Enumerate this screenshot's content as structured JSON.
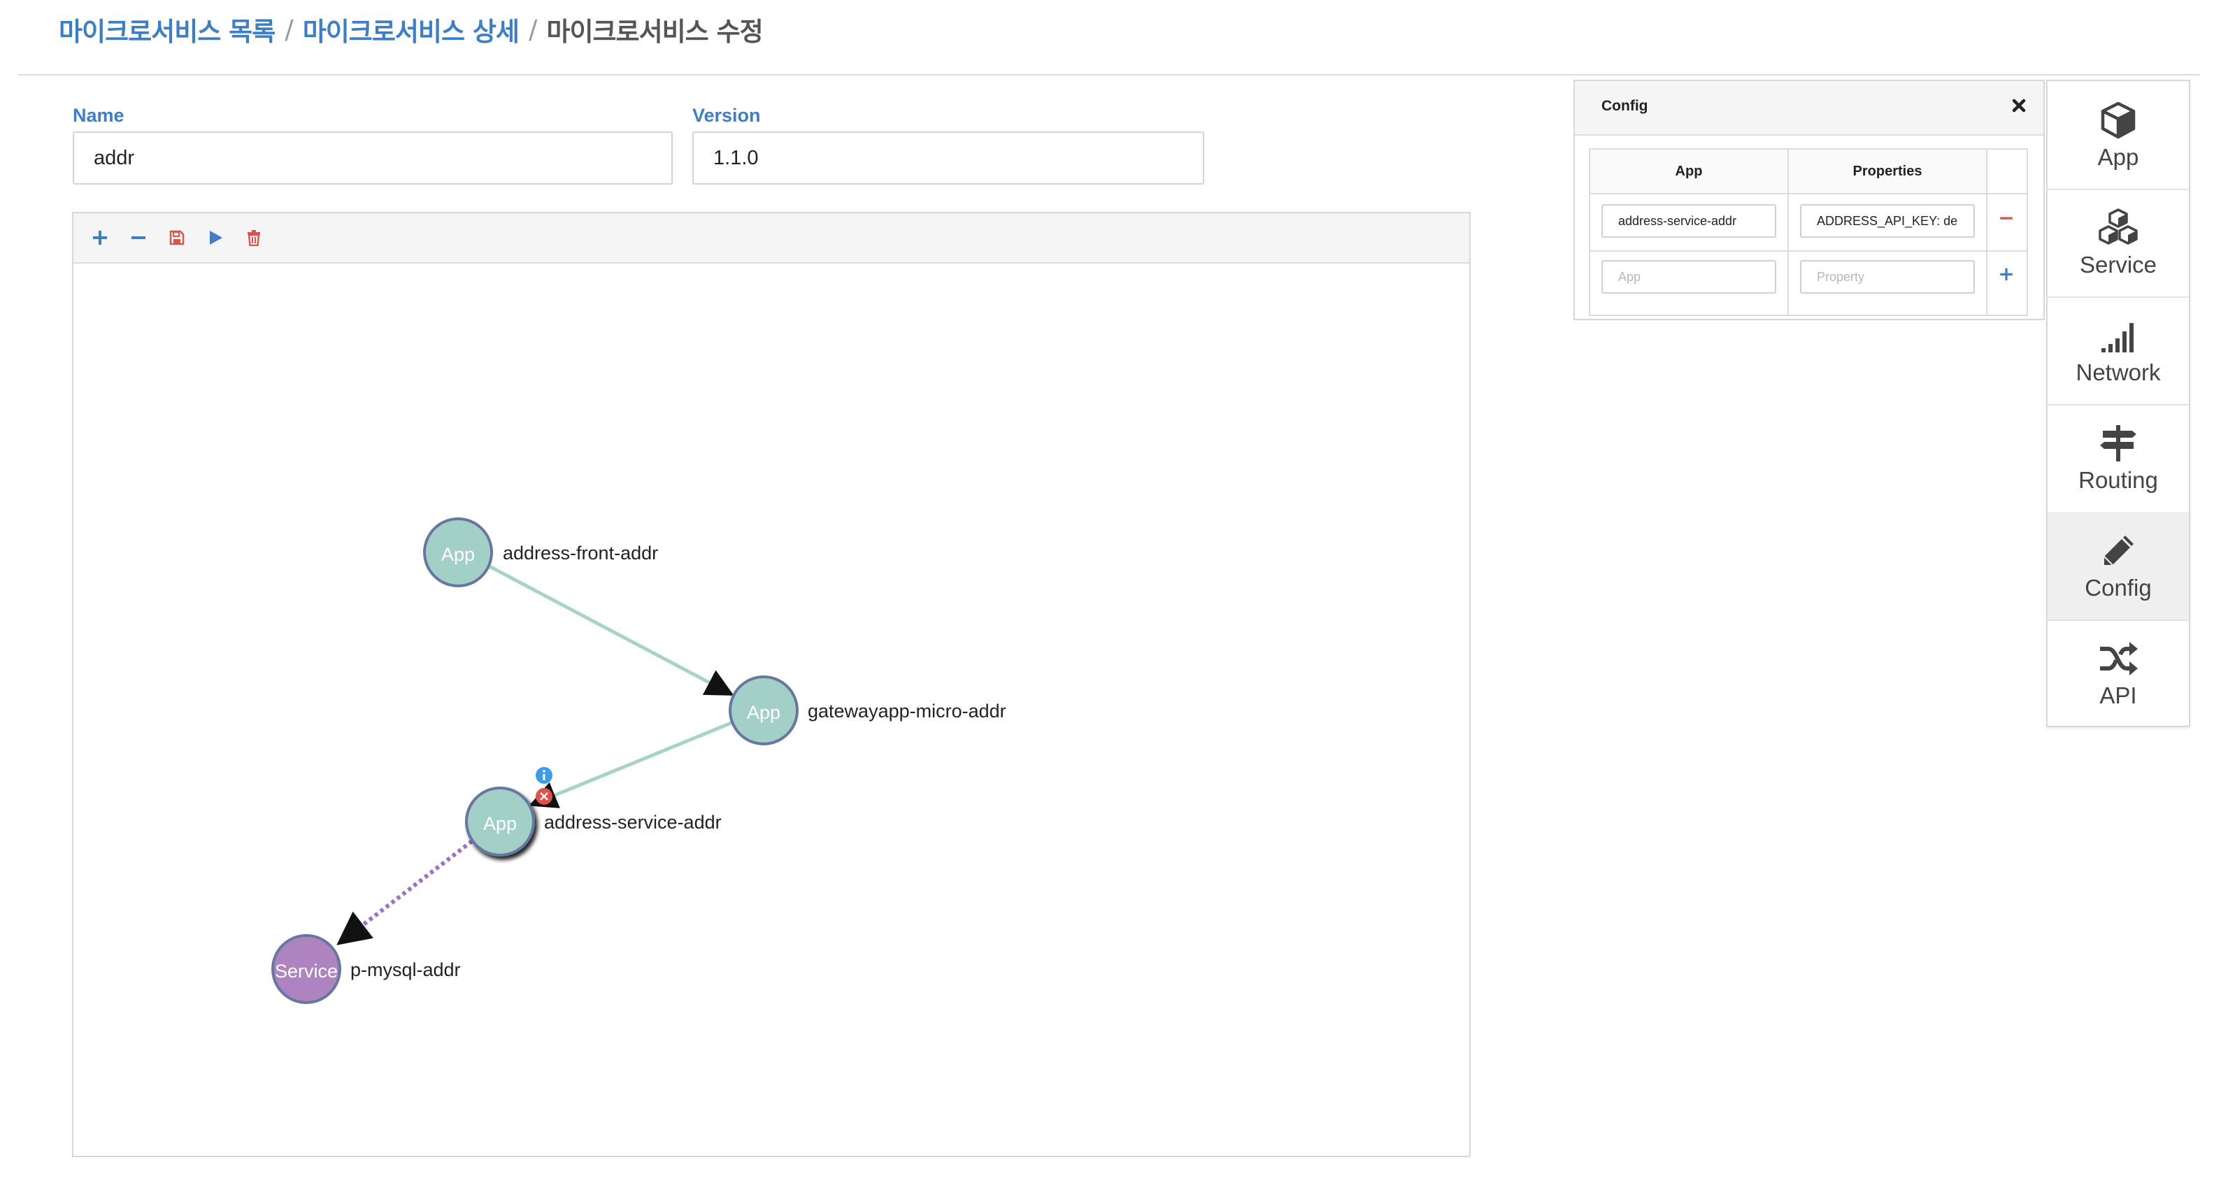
{
  "breadcrumb": {
    "item1": "마이크로서비스 목록",
    "item2": "마이크로서비스 상세",
    "current": "마이크로서비스 수정",
    "separator": "/"
  },
  "form": {
    "name_label": "Name",
    "name_value": "addr",
    "version_label": "Version",
    "version_value": "1.1.0"
  },
  "toolbar": {
    "icons": [
      "plus-icon",
      "minus-icon",
      "save-icon",
      "play-icon",
      "trash-icon"
    ]
  },
  "graph": {
    "nodes": [
      {
        "id": "address-front-addr",
        "type_label": "App",
        "name": "address-front-addr"
      },
      {
        "id": "gatewayapp-micro-addr",
        "type_label": "App",
        "name": "gatewayapp-micro-addr"
      },
      {
        "id": "address-service-addr",
        "type_label": "App",
        "name": "address-service-addr"
      },
      {
        "id": "p-mysql-addr",
        "type_label": "Service",
        "name": "p-mysql-addr"
      }
    ],
    "edges": [
      {
        "from": "address-front-addr",
        "to": "gatewayapp-micro-addr",
        "style": "solid"
      },
      {
        "from": "gatewayapp-micro-addr",
        "to": "address-service-addr",
        "style": "solid"
      },
      {
        "from": "address-service-addr",
        "to": "p-mysql-addr",
        "style": "dotted"
      }
    ],
    "colors": {
      "app": "#a3d0c6",
      "service": "#ad84bf",
      "edge": "#a8d3c6",
      "dotted_edge": "#a070c0",
      "node_border": "#6777a0"
    }
  },
  "config": {
    "title": "Config",
    "col_app": "App",
    "col_properties": "Properties",
    "rows": [
      {
        "app": "address-service-addr",
        "property": "ADDRESS_API_KEY: de"
      }
    ],
    "new_row": {
      "app_placeholder": "App",
      "property_placeholder": "Property"
    },
    "remove_symbol": "−",
    "add_symbol": "+"
  },
  "sidebar": {
    "items": [
      {
        "label": "App",
        "icon": "cube-icon"
      },
      {
        "label": "Service",
        "icon": "cubes-icon"
      },
      {
        "label": "Network",
        "icon": "signal-icon"
      },
      {
        "label": "Routing",
        "icon": "signpost-icon"
      },
      {
        "label": "Config",
        "icon": "pencil-icon",
        "active": true
      },
      {
        "label": "API",
        "icon": "shuffle-icon"
      }
    ]
  },
  "colors": {
    "accent": "#3d7ec4",
    "danger": "#d9534f"
  }
}
